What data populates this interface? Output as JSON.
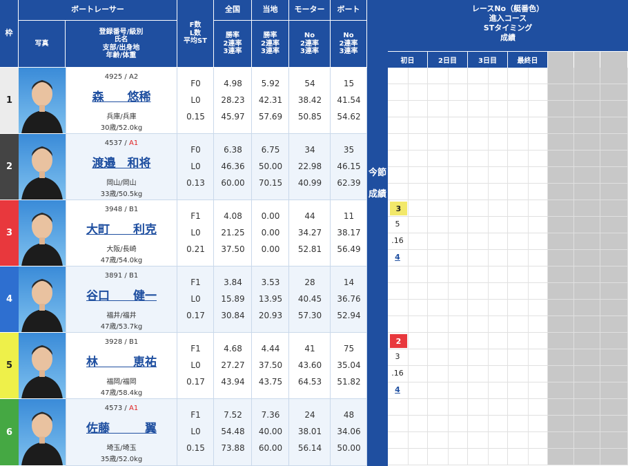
{
  "headers": {
    "waku": "枠",
    "racer": "ボートレーサー",
    "photo": "写真",
    "info": [
      "登録番号/級別",
      "氏名",
      "支部/出身地",
      "年齢/体重"
    ],
    "f": [
      "F数",
      "L数",
      "平均ST"
    ],
    "national": "全国",
    "local": "当地",
    "motor": "モーター",
    "boat": "ボート",
    "rates": [
      "勝率",
      "2連率",
      "3連率"
    ],
    "no_rates": [
      "No",
      "2連率",
      "3連率"
    ],
    "race_info": [
      "レースNo（艇番色）",
      "進入コース",
      "STタイミング",
      "成績"
    ],
    "current": "今節成績",
    "days": [
      "初日",
      "2日目",
      "3日目",
      "最終日",
      "",
      "",
      ""
    ]
  },
  "racers": [
    {
      "waku": "1",
      "waku_color": "#ececec",
      "waku_text": "#222",
      "reg": "4925 / ",
      "cls": "A2",
      "cls_red": false,
      "name": "森　　悠稀",
      "branch": "兵庫/兵庫",
      "age": "30歳/52.0kg",
      "f": [
        "F0",
        "L0",
        "0.15"
      ],
      "nat": [
        "4.98",
        "28.23",
        "45.97"
      ],
      "loc": [
        "5.92",
        "42.31",
        "57.69"
      ],
      "motor": [
        "54",
        "38.42",
        "50.85"
      ],
      "boat": [
        "15",
        "41.54",
        "54.62"
      ],
      "result": null
    },
    {
      "waku": "2",
      "waku_color": "#444444",
      "waku_text": "#ffffff",
      "reg": "4537 / ",
      "cls": "A1",
      "cls_red": true,
      "name": "渡邉　和将",
      "branch": "岡山/岡山",
      "age": "33歳/50.5kg",
      "f": [
        "F0",
        "L0",
        "0.13"
      ],
      "nat": [
        "6.38",
        "46.36",
        "60.00"
      ],
      "loc": [
        "6.75",
        "50.00",
        "70.15"
      ],
      "motor": [
        "34",
        "22.98",
        "40.99"
      ],
      "boat": [
        "35",
        "46.15",
        "62.39"
      ],
      "result": null
    },
    {
      "waku": "3",
      "waku_color": "#e8383d",
      "waku_text": "#ffffff",
      "reg": "3948 / ",
      "cls": "B1",
      "cls_red": false,
      "name": "大町　　利克",
      "branch": "大阪/長崎",
      "age": "47歳/54.0kg",
      "f": [
        "F1",
        "L0",
        "0.21"
      ],
      "nat": [
        "4.08",
        "21.25",
        "37.50"
      ],
      "loc": [
        "0.00",
        "0.00",
        "0.00"
      ],
      "motor": [
        "44",
        "34.27",
        "52.81"
      ],
      "boat": [
        "11",
        "38.17",
        "56.49"
      ],
      "result": {
        "race": "3",
        "bg": "#f2e86a",
        "fg": "#222",
        "course": "5",
        "st": ".16",
        "rank": "4"
      }
    },
    {
      "waku": "4",
      "waku_color": "#2e6fd0",
      "waku_text": "#ffffff",
      "reg": "3891 / ",
      "cls": "B1",
      "cls_red": false,
      "name": "谷口　　健一",
      "branch": "福井/福井",
      "age": "47歳/53.7kg",
      "f": [
        "F1",
        "L0",
        "0.17"
      ],
      "nat": [
        "3.84",
        "15.89",
        "30.84"
      ],
      "loc": [
        "3.53",
        "13.95",
        "20.93"
      ],
      "motor": [
        "28",
        "40.45",
        "57.30"
      ],
      "boat": [
        "14",
        "36.76",
        "52.94"
      ],
      "result": null
    },
    {
      "waku": "5",
      "waku_color": "#eef04a",
      "waku_text": "#222",
      "reg": "3928 / ",
      "cls": "B1",
      "cls_red": false,
      "name": "林　　　恵祐",
      "branch": "福岡/福岡",
      "age": "47歳/58.4kg",
      "f": [
        "F1",
        "L0",
        "0.17"
      ],
      "nat": [
        "4.68",
        "27.27",
        "43.94"
      ],
      "loc": [
        "4.44",
        "37.50",
        "43.75"
      ],
      "motor": [
        "41",
        "43.60",
        "64.53"
      ],
      "boat": [
        "75",
        "35.04",
        "51.82"
      ],
      "result": {
        "race": "2",
        "bg": "#e8383d",
        "fg": "#fff",
        "course": "3",
        "st": ".16",
        "rank": "4"
      }
    },
    {
      "waku": "6",
      "waku_color": "#45a843",
      "waku_text": "#ffffff",
      "reg": "4573 / ",
      "cls": "A1",
      "cls_red": true,
      "name": "佐藤　　　翼",
      "branch": "埼玉/埼玉",
      "age": "35歳/52.0kg",
      "f": [
        "F1",
        "L0",
        "0.15"
      ],
      "nat": [
        "7.52",
        "54.48",
        "73.88"
      ],
      "loc": [
        "7.36",
        "40.00",
        "60.00"
      ],
      "motor": [
        "24",
        "38.01",
        "56.14"
      ],
      "boat": [
        "48",
        "34.06",
        "50.00"
      ],
      "result": null
    }
  ]
}
